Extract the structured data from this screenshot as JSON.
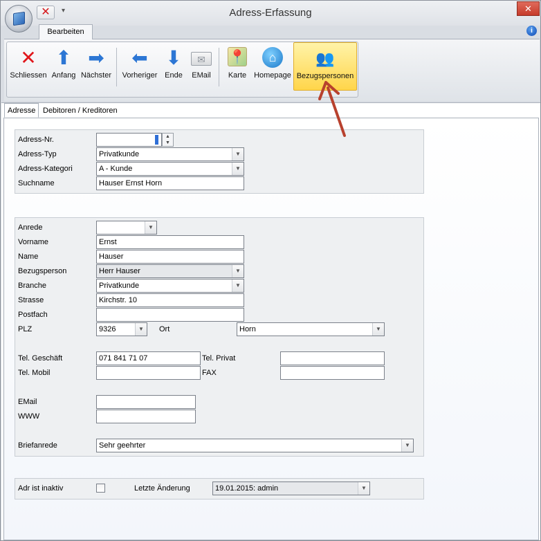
{
  "window": {
    "title": "Adress-Erfassung"
  },
  "icons": {
    "orb": "app-cube-icon",
    "qat_close": "close-x-icon",
    "qat_dropdown": "chevron-down-icon",
    "window_close": "window-close-icon",
    "help": "info-icon"
  },
  "colors": {
    "accent_active": "#ffd54a",
    "close_red": "#e0161b",
    "nav_blue": "#2c76d4",
    "annotation_arrow": "#b8412e"
  },
  "ribbon": {
    "tab_label": "Bearbeiten",
    "buttons": [
      {
        "label": "Schliessen",
        "icon": "close-x-icon"
      },
      {
        "label": "Anfang",
        "icon": "arrow-up-icon"
      },
      {
        "label": "Nächster",
        "icon": "arrow-right-icon"
      },
      {
        "label": "Vorheriger",
        "icon": "arrow-left-icon"
      },
      {
        "label": "Ende",
        "icon": "arrow-down-icon"
      },
      {
        "label": "EMail",
        "icon": "envelope-icon"
      },
      {
        "label": "Karte",
        "icon": "map-pin-icon"
      },
      {
        "label": "Homepage",
        "icon": "home-icon"
      },
      {
        "label": "Bezugspersonen",
        "icon": "people-gear-icon"
      }
    ]
  },
  "tabs": {
    "adresse": "Adresse",
    "debitoren": "Debitoren / Kreditoren"
  },
  "form": {
    "adress_nr": {
      "label": "Adress-Nr.",
      "value": ""
    },
    "adress_typ": {
      "label": "Adress-Typ",
      "value": "Privatkunde"
    },
    "adress_kategori": {
      "label": "Adress-Kategori",
      "value": "A - Kunde"
    },
    "suchname": {
      "label": "Suchname",
      "value": "Hauser Ernst Horn"
    },
    "anrede": {
      "label": "Anrede",
      "value": ""
    },
    "vorname": {
      "label": "Vorname",
      "value": "Ernst"
    },
    "name": {
      "label": "Name",
      "value": "Hauser"
    },
    "bezugsperson": {
      "label": "Bezugsperson",
      "value": "Herr Hauser"
    },
    "branche": {
      "label": "Branche",
      "value": "Privatkunde"
    },
    "strasse": {
      "label": "Strasse",
      "value": "Kirchstr. 10"
    },
    "postfach": {
      "label": "Postfach",
      "value": ""
    },
    "plz": {
      "label": "PLZ",
      "value": "9326"
    },
    "ort": {
      "label": "Ort",
      "value": "Horn"
    },
    "tel_geschaeft": {
      "label": "Tel. Geschäft",
      "value": "071 841 71 07"
    },
    "tel_privat": {
      "label": "Tel. Privat",
      "value": ""
    },
    "tel_mobil": {
      "label": "Tel. Mobil",
      "value": ""
    },
    "fax": {
      "label": "FAX",
      "value": ""
    },
    "email": {
      "label": "EMail",
      "value": ""
    },
    "www": {
      "label": "WWW",
      "value": ""
    },
    "briefanrede": {
      "label": "Briefanrede",
      "value": "Sehr geehrter"
    },
    "inaktiv": {
      "label": "Adr ist inaktiv",
      "checked": false
    },
    "letzte_aenderung": {
      "label": "Letzte Änderung",
      "value": "19.01.2015: admin"
    }
  }
}
